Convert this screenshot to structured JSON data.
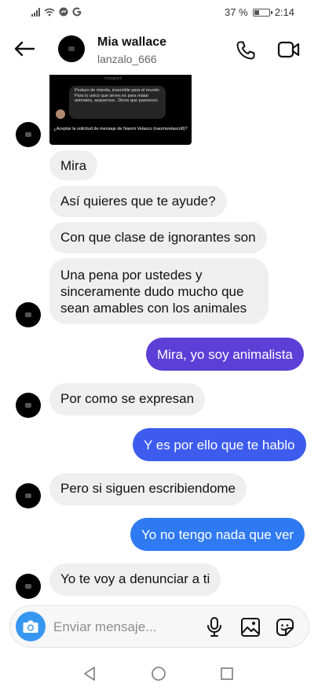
{
  "status_bar": {
    "battery": "37 %",
    "time": "2:14",
    "battery_level": 0.37
  },
  "header": {
    "name": "Mia wallace",
    "username": "lanzalo_666"
  },
  "shared_image": {
    "top_text": "Instagram",
    "quoted_message": "Pedazo de mierda, inservible para el mundo. Para lo unico que sirves es para matar animales, asqueroso.. Dinos que pasooooo",
    "request_text": "¿Aceptar la solicitud de mensaje de Naomi Velasco (naomivelasco8)?"
  },
  "messages": [
    {
      "side": "in",
      "text": "Mira"
    },
    {
      "side": "in",
      "text": "Así quieres que te ayude?"
    },
    {
      "side": "in",
      "text": "Con que clase de ignorantes son"
    },
    {
      "side": "in",
      "text": "Una pena por ustedes y sinceramente dudo mucho que sean amables con los animales"
    },
    {
      "side": "out",
      "text": "Mira, yo soy animalista",
      "color": "#5b3fd6"
    },
    {
      "side": "in",
      "text": "Por como se expresan"
    },
    {
      "side": "out",
      "text": "Y es por ello que te hablo",
      "color": "#3d5bed"
    },
    {
      "side": "in",
      "text": "Pero si siguen escribiendome"
    },
    {
      "side": "out",
      "text": "Yo no tengo nada que ver",
      "color": "#2f7af2"
    },
    {
      "side": "in",
      "text": "Yo te voy a denunciar a ti"
    }
  ],
  "composer": {
    "placeholder": "Enviar mensaje..."
  },
  "colors": {
    "accent": "#3797f0",
    "incoming_bubble": "#efefef"
  },
  "icons": [
    "back-arrow-icon",
    "phone-icon",
    "video-camera-icon",
    "camera-icon",
    "microphone-icon",
    "gallery-icon",
    "sticker-icon"
  ]
}
